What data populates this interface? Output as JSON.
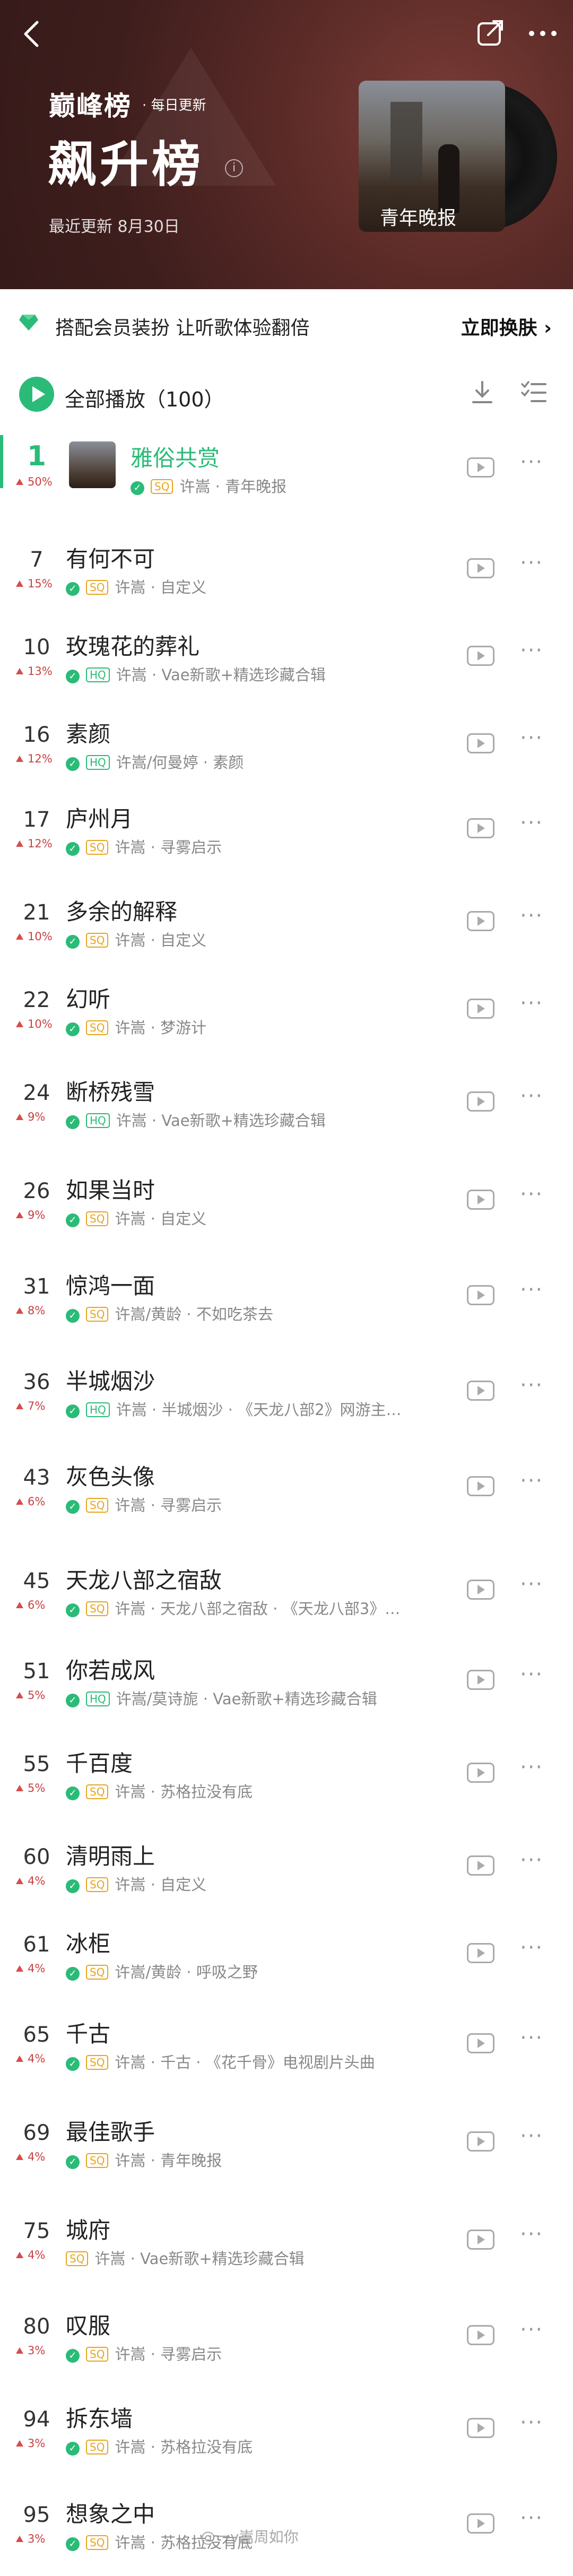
{
  "header": {
    "brand": "巅峰榜",
    "daily": "· 每日更新",
    "title": "飙升榜",
    "updated": "最近更新 8月30日",
    "cover_text": "青年晚报"
  },
  "member_banner": {
    "text": "搭配会员装扮  让听歌体验翻倍",
    "cta": "立即换肤 ›"
  },
  "play_all": {
    "label": "全部播放（100）"
  },
  "songs": [
    {
      "rank": "1",
      "delta": "50%",
      "title": "雅俗共赏",
      "quality": "SQ",
      "meta": "许嵩 · 青年晚报"
    },
    {
      "rank": "7",
      "delta": "15%",
      "title": "有何不可",
      "quality": "SQ",
      "meta": "许嵩 · 自定义"
    },
    {
      "rank": "10",
      "delta": "13%",
      "title": "玫瑰花的葬礼",
      "quality": "HQ",
      "meta": "许嵩 · Vae新歌+精选珍藏合辑"
    },
    {
      "rank": "16",
      "delta": "12%",
      "title": "素颜",
      "quality": "HQ",
      "meta": "许嵩/何曼婷 · 素颜"
    },
    {
      "rank": "17",
      "delta": "12%",
      "title": "庐州月",
      "quality": "SQ",
      "meta": "许嵩 · 寻雾启示"
    },
    {
      "rank": "21",
      "delta": "10%",
      "title": "多余的解释",
      "quality": "SQ",
      "meta": "许嵩 · 自定义"
    },
    {
      "rank": "22",
      "delta": "10%",
      "title": "幻听",
      "quality": "SQ",
      "meta": "许嵩 · 梦游计"
    },
    {
      "rank": "24",
      "delta": "9%",
      "title": "断桥残雪",
      "quality": "HQ",
      "meta": "许嵩 · Vae新歌+精选珍藏合辑"
    },
    {
      "rank": "26",
      "delta": "9%",
      "title": "如果当时",
      "quality": "SQ",
      "meta": "许嵩 · 自定义"
    },
    {
      "rank": "31",
      "delta": "8%",
      "title": "惊鸿一面",
      "quality": "SQ",
      "meta": "许嵩/黄龄 · 不如吃茶去"
    },
    {
      "rank": "36",
      "delta": "7%",
      "title": "半城烟沙",
      "quality": "HQ",
      "meta": "许嵩 · 半城烟沙 · 《天龙八部2》网游主…"
    },
    {
      "rank": "43",
      "delta": "6%",
      "title": "灰色头像",
      "quality": "SQ",
      "meta": "许嵩 · 寻雾启示"
    },
    {
      "rank": "45",
      "delta": "6%",
      "title": "天龙八部之宿敌",
      "quality": "SQ",
      "meta": "许嵩 · 天龙八部之宿敌 · 《天龙八部3》…"
    },
    {
      "rank": "51",
      "delta": "5%",
      "title": "你若成风",
      "quality": "HQ",
      "meta": "许嵩/莫诗旎 · Vae新歌+精选珍藏合辑"
    },
    {
      "rank": "55",
      "delta": "5%",
      "title": "千百度",
      "quality": "SQ",
      "meta": "许嵩 · 苏格拉没有底"
    },
    {
      "rank": "60",
      "delta": "4%",
      "title": "清明雨上",
      "quality": "SQ",
      "meta": "许嵩 · 自定义"
    },
    {
      "rank": "61",
      "delta": "4%",
      "title": "冰柜",
      "quality": "SQ",
      "meta": "许嵩/黄龄 · 呼吸之野"
    },
    {
      "rank": "65",
      "delta": "4%",
      "title": "千古",
      "quality": "SQ",
      "meta": "许嵩 · 千古 · 《花千骨》电视剧片头曲"
    },
    {
      "rank": "69",
      "delta": "4%",
      "title": "最佳歌手",
      "quality": "SQ",
      "meta": "许嵩 · 青年晚报"
    },
    {
      "rank": "75",
      "delta": "4%",
      "title": "城府",
      "quality": "SQ",
      "meta": "许嵩 · Vae新歌+精选珍藏合辑",
      "nocheck": true
    },
    {
      "rank": "80",
      "delta": "3%",
      "title": "叹服",
      "quality": "SQ",
      "meta": "许嵩 · 寻雾启示"
    },
    {
      "rank": "94",
      "delta": "3%",
      "title": "拆东墙",
      "quality": "SQ",
      "meta": "许嵩 · 苏格拉没有底"
    },
    {
      "rank": "95",
      "delta": "3%",
      "title": "想象之中",
      "quality": "SQ",
      "meta": "许嵩 · 苏格拉没有底"
    }
  ],
  "watermark": "@一v嵩周如你",
  "colors": {
    "accent": "#2bbb78",
    "header_bg": "#4a2422",
    "rise": "#d94b4b",
    "sq": "#e7a51e"
  }
}
